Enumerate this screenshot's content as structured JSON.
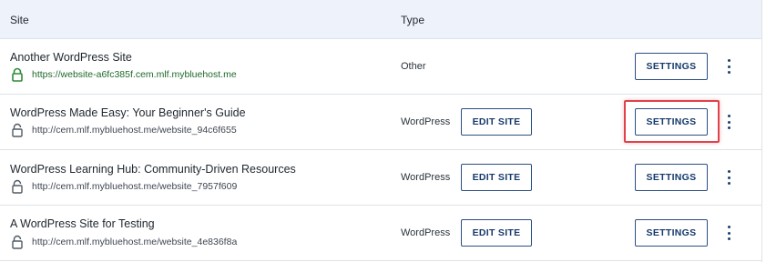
{
  "header": {
    "site": "Site",
    "type": "Type"
  },
  "rows": [
    {
      "title": "Another WordPress Site",
      "url": "https://website-a6fc385f.cem.mlf.mybluehost.me",
      "type": "Other",
      "lock": "lock-closed-green-icon",
      "edit_label": "",
      "settings_label": "SETTINGS"
    },
    {
      "title": "WordPress Made Easy: Your Beginner's Guide",
      "url": "http://cem.mlf.mybluehost.me/website_94c6f655",
      "type": "WordPress",
      "lock": "lock-open-gray-icon",
      "edit_label": "EDIT SITE",
      "settings_label": "SETTINGS"
    },
    {
      "title": "WordPress Learning Hub: Community-Driven Resources",
      "url": "http://cem.mlf.mybluehost.me/website_7957f609",
      "type": "WordPress",
      "lock": "lock-open-gray-icon",
      "edit_label": "EDIT SITE",
      "settings_label": "SETTINGS"
    },
    {
      "title": "A WordPress Site for Testing",
      "url": "http://cem.mlf.mybluehost.me/website_4e836f8a",
      "type": "WordPress",
      "lock": "lock-open-gray-icon",
      "edit_label": "EDIT SITE",
      "settings_label": "SETTINGS"
    }
  ],
  "colors": {
    "accent": "#163a6b",
    "highlight": "#e0414a",
    "secure": "#1e6a2a"
  }
}
